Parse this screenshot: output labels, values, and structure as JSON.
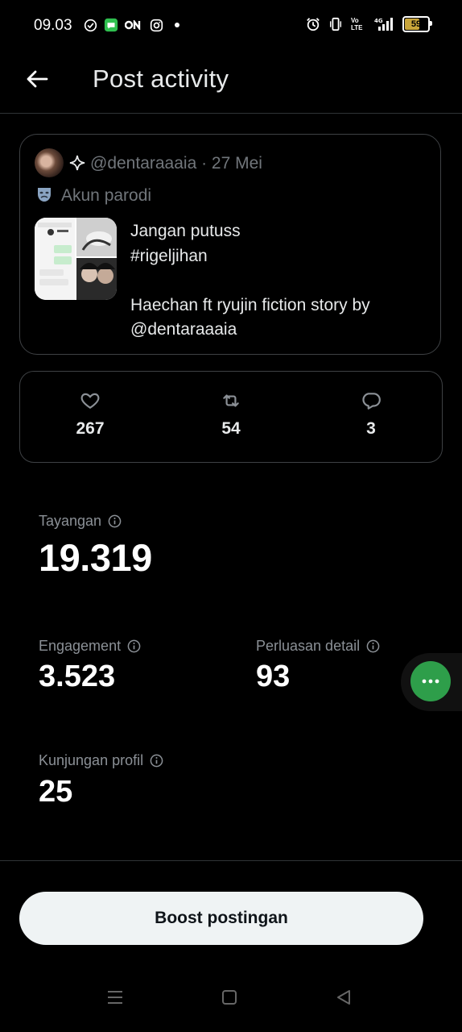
{
  "status_bar": {
    "time": "09.03",
    "battery": "59",
    "network_label": "4G",
    "volte_label": "Vo LTE"
  },
  "header": {
    "title": "Post activity"
  },
  "post": {
    "meta": "@dentaraaaia · 27 Mei",
    "parody_label": "Akun parodi",
    "text": "Jangan putuss\n#rigeljihan\n\nHaechan ft ryujin fiction story by @dentaraaaia"
  },
  "engagement": {
    "likes": "267",
    "reposts": "54",
    "replies": "3"
  },
  "metrics": {
    "impressions_label": "Tayangan",
    "impressions_value": "19.319",
    "engagement_label": "Engagement",
    "engagement_value": "3.523",
    "detail_label": "Perluasan detail",
    "detail_value": "93",
    "profile_label": "Kunjungan profil",
    "profile_value": "25"
  },
  "boost": {
    "label": "Boost postingan"
  },
  "colors": {
    "background": "#000000",
    "text_primary": "#e7e9ea",
    "text_secondary": "#71767b",
    "border": "#3e4144",
    "fab": "#2e9e4a",
    "button_bg": "#eff3f4"
  }
}
